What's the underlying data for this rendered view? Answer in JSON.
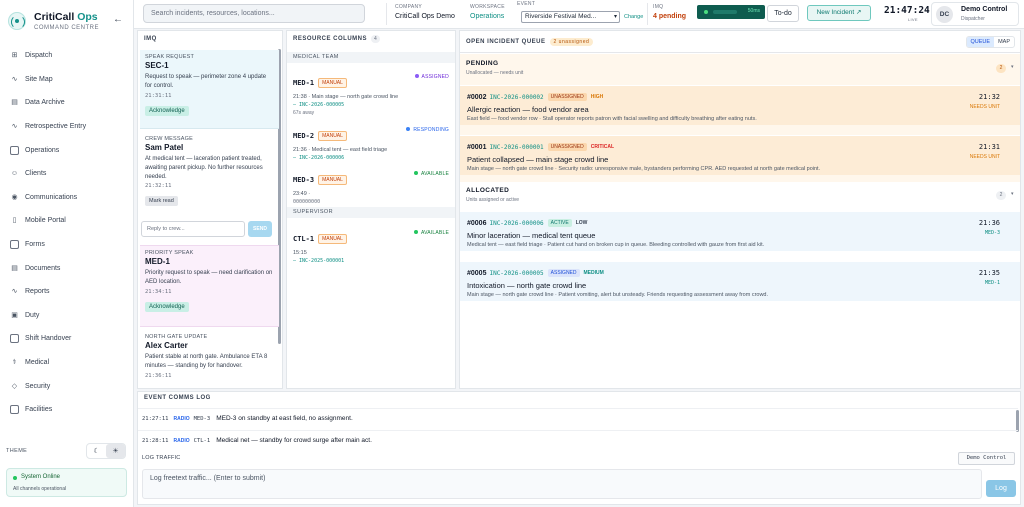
{
  "brand": {
    "name_a": "CritiCall",
    "name_b": "Ops",
    "subtitle": "COMMAND CENTRE"
  },
  "sidebar": {
    "items": [
      {
        "label": "Dispatch",
        "icon": "grid-icon"
      },
      {
        "label": "Site Map",
        "icon": "pulse-icon"
      },
      {
        "label": "Data Archive",
        "icon": "document-icon"
      },
      {
        "label": "Retrospective Entry",
        "icon": "pulse-icon"
      },
      {
        "label": "Operations",
        "icon": "calendar-icon"
      },
      {
        "label": "Clients",
        "icon": "user-icon"
      },
      {
        "label": "Communications",
        "icon": "radio-icon"
      },
      {
        "label": "Mobile Portal",
        "icon": "phone-icon"
      },
      {
        "label": "Forms",
        "icon": "form-icon"
      },
      {
        "label": "Documents",
        "icon": "document-icon"
      },
      {
        "label": "Reports",
        "icon": "pulse-icon"
      },
      {
        "label": "Duty",
        "icon": "clipboard-icon"
      },
      {
        "label": "Shift Handover",
        "icon": "handover-icon"
      },
      {
        "label": "Medical",
        "icon": "stethoscope-icon"
      },
      {
        "label": "Security",
        "icon": "shield-icon"
      },
      {
        "label": "Facilities",
        "icon": "building-icon"
      }
    ],
    "theme_label": "THEME",
    "system_status": "System Online",
    "system_detail": "All channels operational"
  },
  "topbar": {
    "search_placeholder": "Search incidents, resources, locations...",
    "company_label": "COMPANY",
    "company_value": "CritiCall Ops Demo",
    "workspace_label": "WORKSPACE",
    "workspace_value": "Operations",
    "event_label": "EVENT",
    "event_value": "Riverside Festival Med...",
    "change_label": "Change",
    "imq_label": "IMQ",
    "imq_value": "4 pending",
    "status_value": "50ms",
    "todo_label": "To-do",
    "new_incident_label": "New Incident ↗",
    "clock": "21:47:24",
    "clock_sub": "LIVE",
    "user_initials": "DC",
    "user_name": "Demo Control",
    "user_role": "Dispatcher"
  },
  "imq": {
    "title": "IMQ",
    "messages": [
      {
        "label": "SPEAK REQUEST",
        "heading": "SEC-1",
        "body": "Request to speak — perimeter zone 4 update for control.",
        "time": "21:31:11",
        "action": "Acknowledge"
      },
      {
        "label": "CREW MESSAGE",
        "heading": "Sam Patel",
        "body": "At medical tent — laceration patient treated, awaiting parent pickup. No further resources needed.",
        "time": "21:32:11",
        "action": "Mark read"
      },
      {
        "label": "PRIORITY SPEAK",
        "heading": "MED-1",
        "body": "Priority request to speak — need clarification on AED location.",
        "time": "21:34:11",
        "action": "Acknowledge"
      },
      {
        "label": "NORTH GATE UPDATE",
        "heading": "Alex Carter",
        "body": "Patient stable at north gate. Ambulance ETA 8 minutes — standing by for handover.",
        "time": "21:36:11"
      }
    ],
    "reply_placeholder": "Reply to crew...",
    "send_label": "SEND"
  },
  "resources": {
    "title": "RESOURCE COLUMNS",
    "count": "4",
    "sections": {
      "medical": "MEDICAL TEAM",
      "supervisor": "SUPERVISOR"
    },
    "units": [
      {
        "id": "MED-1",
        "tag": "MANUAL",
        "status": "ASSIGNED",
        "note": "21:38 · Main stage — north gate crowd line",
        "ref": "— INC-2026-000005",
        "meta": "67s away"
      },
      {
        "id": "MED-2",
        "tag": "MANUAL",
        "status": "RESPONDING",
        "note": "21:36 · Medical tent — east field triage",
        "ref": "— INC-2026-000006"
      },
      {
        "id": "MED-3",
        "tag": "MANUAL",
        "status": "AVAILABLE",
        "note": "23:49 ·",
        "meta": "000000000"
      },
      {
        "id": "CTL-1",
        "tag": "MANUAL",
        "status": "AVAILABLE",
        "note": "15:15",
        "ref": "— INC-2025-000001"
      }
    ]
  },
  "queue": {
    "title": "OPEN INCIDENT QUEUE",
    "badge": "2 unassigned",
    "tabs": [
      "QUEUE",
      "MAP"
    ],
    "groups": {
      "pending": {
        "title": "PENDING",
        "sub": "Unallocated — needs unit",
        "count": "2"
      },
      "allocated": {
        "title": "ALLOCATED",
        "sub": "Units assigned or active",
        "count": "2"
      }
    },
    "incidents": [
      {
        "code": "#0002",
        "ref": "INC-2026-000002",
        "status": "UNASSIGNED",
        "priority": "HIGH",
        "title": "Allergic reaction — food vendor area",
        "detail": "East field — food vendor row · Stall operator reports patron with facial swelling and difficulty breathing after eating nuts.",
        "time": "21:32",
        "sub": "NEEDS UNIT"
      },
      {
        "code": "#0001",
        "ref": "INC-2026-000001",
        "status": "UNASSIGNED",
        "priority": "CRITICAL",
        "title": "Patient collapsed — main stage crowd line",
        "detail": "Main stage — north gate crowd line · Security radio: unresponsive male, bystanders performing CPR. AED requested at north gate medical point.",
        "time": "21:31",
        "sub": "NEEDS UNIT"
      },
      {
        "code": "#0006",
        "ref": "INC-2026-000006",
        "status": "ACTIVE",
        "priority": "LOW",
        "title": "Minor laceration — medical tent queue",
        "detail": "Medical tent — east field triage · Patient cut hand on broken cup in queue. Bleeding controlled with gauze from first aid kit.",
        "time": "21:36",
        "sub": "MED-3"
      },
      {
        "code": "#0005",
        "ref": "INC-2026-000005",
        "status": "ASSIGNED",
        "priority": "MEDIUM",
        "title": "Intoxication — north gate crowd line",
        "detail": "Main stage — north gate crowd line · Patient vomiting, alert but unsteady. Friends requesting assessment away from crowd.",
        "time": "21:35",
        "sub": "MED-1"
      }
    ]
  },
  "comms": {
    "title": "EVENT COMMS LOG",
    "rows": [
      {
        "time": "21:27:11",
        "channel": "RADIO",
        "unit": "MED-3",
        "message": "MED-3 on standby at east field, no assignment."
      },
      {
        "time": "21:28:11",
        "channel": "RADIO",
        "unit": "CTL-1",
        "message": "Medical net — standby for crowd surge after main act."
      }
    ],
    "log_label": "LOG TRAFFIC",
    "log_as": "Demo Control",
    "log_placeholder": "Log freetext traffic... (Enter to submit)",
    "log_button": "Log"
  },
  "colors": {
    "accent": "#14918a",
    "pending_bg": "#fff7ec",
    "allocated_bg": "#f3f8fe",
    "critical": "#dc2626",
    "high": "#d97706"
  }
}
